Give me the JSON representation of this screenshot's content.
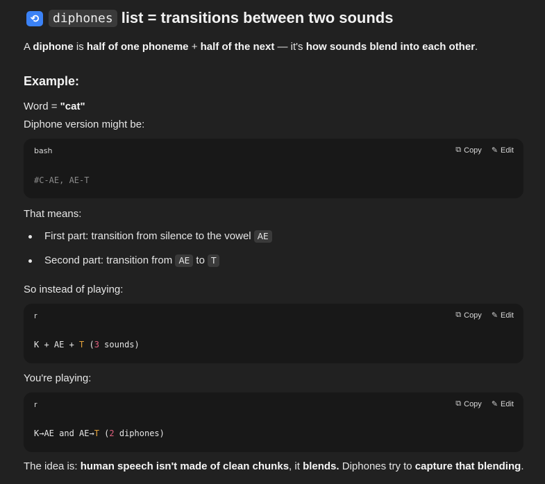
{
  "header": {
    "icon": "repeat-icon",
    "code": "diphones",
    "title_rest": "list = transitions between two sounds"
  },
  "intro": {
    "t1": "A ",
    "b1": "diphone",
    "t2": " is ",
    "b2": "half of one phoneme",
    "t3": " + ",
    "b3": "half of the next",
    "t4": " — it's ",
    "b4": "how sounds blend into each other",
    "t5": "."
  },
  "example_heading": "Example:",
  "word_line": {
    "prefix": "Word = ",
    "word": "\"cat\""
  },
  "diphone_version": "Diphone version might be:",
  "code1": {
    "lang": "bash",
    "copy": "Copy",
    "edit": "Edit",
    "line": "#C-AE, AE-T"
  },
  "that_means": "That means:",
  "bullets": {
    "b1_text": "First part: transition from silence to the vowel ",
    "b1_code": "AE",
    "b2_text": "Second part: transition from ",
    "b2_code1": "AE",
    "b2_mid": " to ",
    "b2_code2": "T"
  },
  "instead": "So instead of playing:",
  "code2": {
    "lang": "r",
    "copy": "Copy",
    "edit": "Edit",
    "p1": "K + AE + ",
    "t": "T",
    "p2": " (",
    "n": "3",
    "p3": " sounds)"
  },
  "playing": "You're playing:",
  "code3": {
    "lang": "r",
    "copy": "Copy",
    "edit": "Edit",
    "p1": "K→AE and AE→",
    "t": "T",
    "p2": " (",
    "n": "2",
    "p3": " diphones)"
  },
  "outro": {
    "t1": "The idea is: ",
    "b1": "human speech isn't made of clean chunks",
    "t2": ", it ",
    "b2": "blends.",
    "t3": " Diphones try to ",
    "b3": "capture that blending",
    "t4": "."
  }
}
